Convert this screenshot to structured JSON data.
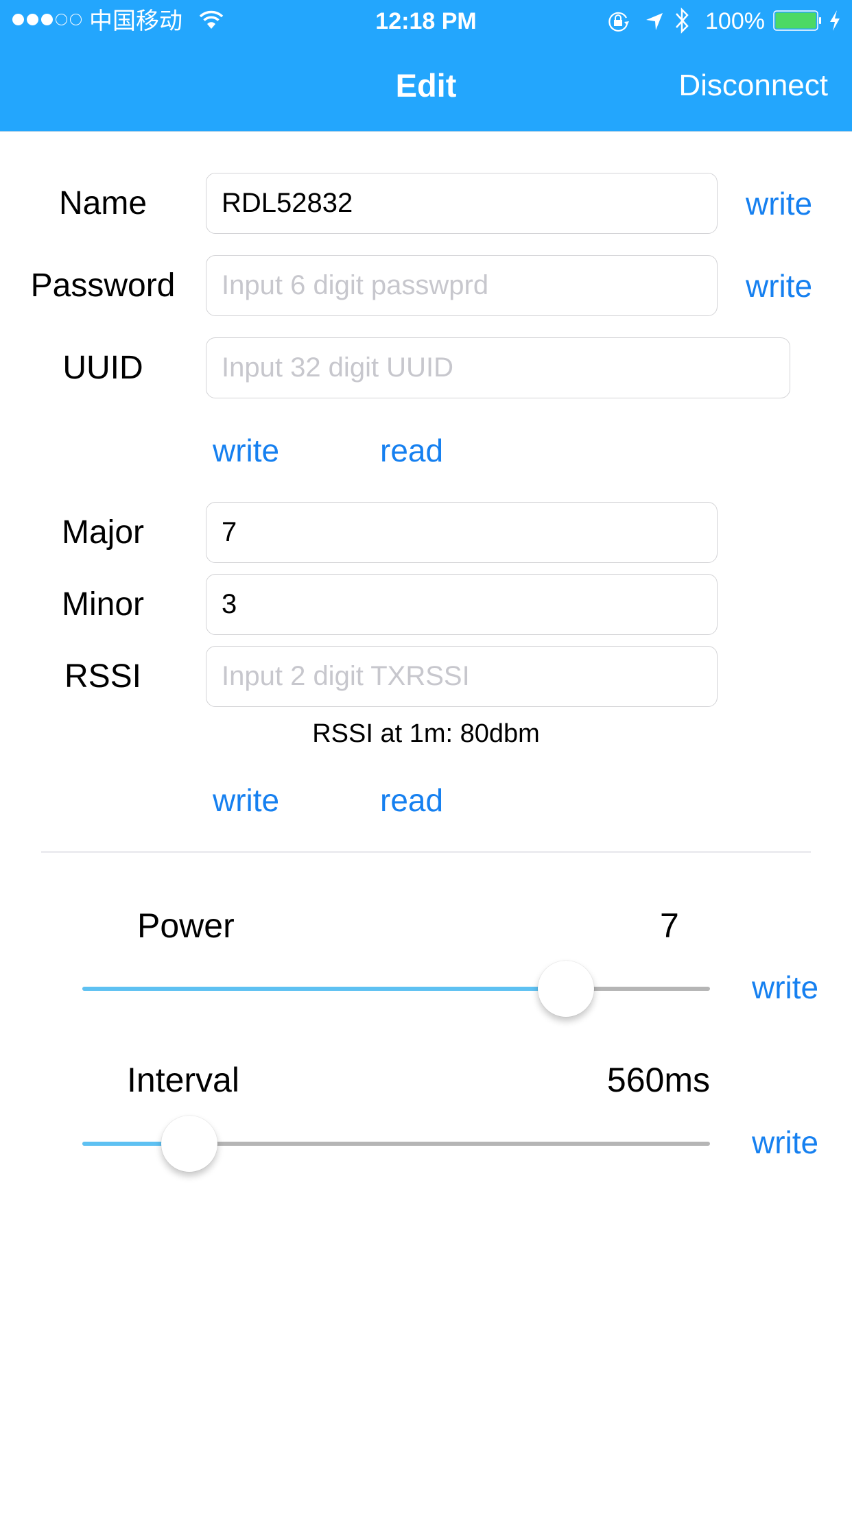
{
  "status_bar": {
    "signal_bars_filled": 3,
    "signal_bars_total": 5,
    "carrier": "中国移动",
    "time": "12:18 PM",
    "battery_percent": "100%",
    "icons": [
      "wifi-icon",
      "rotation-lock-icon",
      "location-arrow-icon",
      "bluetooth-icon",
      "battery-icon",
      "charging-bolt-icon"
    ],
    "battery_color": "#4cd964"
  },
  "nav": {
    "title": "Edit",
    "right_button": "Disconnect",
    "background_color": "#23a6fd"
  },
  "form": {
    "name": {
      "label": "Name",
      "value": "RDL52832",
      "placeholder": "",
      "action": "write"
    },
    "password": {
      "label": "Password",
      "value": "",
      "placeholder": "Input 6 digit passwprd",
      "action": "write"
    },
    "uuid": {
      "label": "UUID",
      "value": "",
      "placeholder": "Input 32 digit UUID"
    },
    "uuid_actions": {
      "write": "write",
      "read": "read"
    },
    "major": {
      "label": "Major",
      "value": "7",
      "placeholder": ""
    },
    "minor": {
      "label": "Minor",
      "value": "3",
      "placeholder": ""
    },
    "rssi": {
      "label": "RSSI",
      "value": "",
      "placeholder": "Input 2 digit TXRSSI"
    },
    "rssi_note": "RSSI at 1m: 80dbm",
    "ibeacon_actions": {
      "write": "write",
      "read": "read"
    }
  },
  "sliders": {
    "power": {
      "label": "Power",
      "value_text": "7",
      "fraction": 0.77,
      "action": "write"
    },
    "interval": {
      "label": "Interval",
      "value_text": "560ms",
      "fraction": 0.17,
      "action": "write"
    }
  },
  "colors": {
    "link": "#1680f0",
    "slider_fill": "#5ec1f2",
    "slider_track": "#b5b5b5"
  }
}
